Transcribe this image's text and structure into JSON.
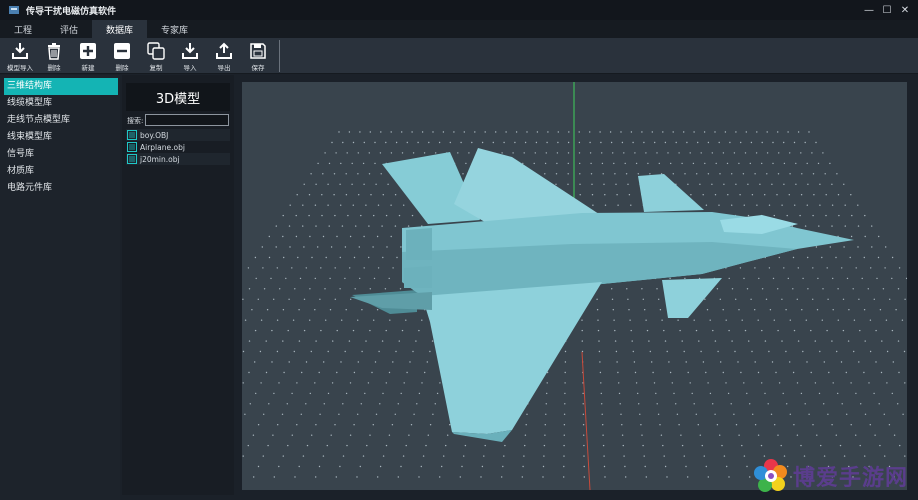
{
  "app": {
    "title": "传导干扰电磁仿真软件"
  },
  "window_controls": {
    "minimize": "—",
    "maximize": "☐",
    "close": "✕"
  },
  "tabs": [
    {
      "label": "工程",
      "active": false
    },
    {
      "label": "评估",
      "active": false
    },
    {
      "label": "数据库",
      "active": true
    },
    {
      "label": "专家库",
      "active": false
    }
  ],
  "toolbar": {
    "model_import": "模型导入",
    "delete": "删除",
    "new": "新建",
    "remove": "删除",
    "copy": "复制",
    "import": "导入",
    "export": "导出",
    "save": "保存"
  },
  "sidebar": {
    "items": [
      {
        "label": "三维结构库",
        "selected": true
      },
      {
        "label": "线缆模型库",
        "selected": false
      },
      {
        "label": "走线节点模型库",
        "selected": false
      },
      {
        "label": "线束模型库",
        "selected": false
      },
      {
        "label": "信号库",
        "selected": false
      },
      {
        "label": "材质库",
        "selected": false
      },
      {
        "label": "电路元件库",
        "selected": false
      }
    ]
  },
  "model_panel": {
    "title": "3D模型",
    "search_label": "搜索:",
    "search_value": "",
    "files": [
      "boy.OBJ",
      "Airplane.obj",
      "j20min.obj"
    ]
  },
  "colors": {
    "accent": "#14b4b4",
    "viewport_bg": "#39444d",
    "model": "#7fc6d2",
    "axis_y": "#3fd05a",
    "axis_z": "#c94a3a"
  },
  "watermark": {
    "text": "博爱手游网"
  }
}
